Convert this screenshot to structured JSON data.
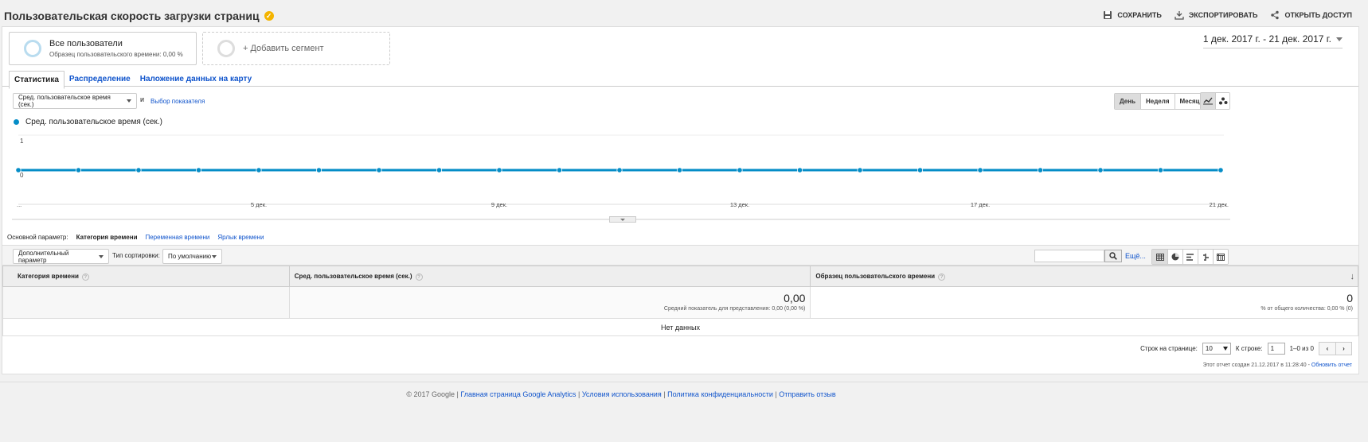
{
  "header": {
    "title": "Пользовательская скорость загрузки страниц",
    "verified_glyph": "✓",
    "actions": {
      "save": "СОХРАНИТЬ",
      "export": "ЭКСПОРТИРОВАТЬ",
      "share": "ОТКРЫТЬ ДОСТУП"
    }
  },
  "segments": {
    "all_users": "Все пользователи",
    "sample": "Образец пользовательского времени: 0,00 %",
    "add": "+ Добавить сегмент"
  },
  "date_range": "1 дек. 2017 г. - 21 дек. 2017 г.",
  "tabs": [
    "Статистика",
    "Распределение",
    "Наложение данных на карту"
  ],
  "metric": {
    "selected": "Сред. пользовательское время (сек.)",
    "and": "и",
    "pick": "Выбор показателя"
  },
  "period_buttons": [
    "День",
    "Неделя",
    "Месяц"
  ],
  "colors": {
    "series": "#058dc7",
    "link": "#1155cc"
  },
  "chart_data": {
    "type": "line",
    "series": [
      {
        "name": "Сред. пользовательское время (сек.)",
        "x": [
          "1 дек.",
          "2 дек.",
          "3 дек.",
          "4 дек.",
          "5 дек.",
          "6 дек.",
          "7 дек.",
          "8 дек.",
          "9 дек.",
          "10 дек.",
          "11 дек.",
          "12 дек.",
          "13 дек.",
          "14 дек.",
          "15 дек.",
          "16 дек.",
          "17 дек.",
          "18 дек.",
          "19 дек.",
          "20 дек.",
          "21 дек."
        ],
        "values": [
          0,
          0,
          0,
          0,
          0,
          0,
          0,
          0,
          0,
          0,
          0,
          0,
          0,
          0,
          0,
          0,
          0,
          0,
          0,
          0,
          0
        ]
      }
    ],
    "ylim": [
      0,
      1
    ],
    "y_ticks": [
      "1",
      "0"
    ],
    "x_ticks": [
      {
        "index": 0,
        "label": "..."
      },
      {
        "index": 4,
        "label": "5 дек."
      },
      {
        "index": 8,
        "label": "9 дек."
      },
      {
        "index": 12,
        "label": "13 дек."
      },
      {
        "index": 16,
        "label": "17 дек."
      },
      {
        "index": 20,
        "label": "21 дек."
      }
    ],
    "grid": true,
    "legend": "top-left"
  },
  "primary_dimension": {
    "label": "Основной параметр:",
    "current": "Категория времени",
    "options": [
      "Переменная времени",
      "Ярлык времени"
    ]
  },
  "toolbar": {
    "secondary": "Дополнительный параметр",
    "sort_label": "Тип сортировки:",
    "sort_value": "По умолчанию",
    "more": "Ещё..."
  },
  "table": {
    "headers": [
      "Категория времени",
      "Сред. пользовательское время (сек.)",
      "Образец пользовательского времени"
    ],
    "help_glyph": "?",
    "sort_glyph": "↓",
    "totals": {
      "avg_value": "0,00",
      "avg_sub": "Средний показатель для представления: 0,00 (0,00 %)",
      "sample_value": "0",
      "sample_sub": "% от общего количества: 0,00 % (0)"
    },
    "no_data": "Нет данных"
  },
  "pager": {
    "rows_label": "Строк на странице:",
    "rows_value": "10",
    "goto_label": "К строке:",
    "goto_value": "1",
    "range": "1–0 из 0",
    "prev": "‹",
    "next": "›"
  },
  "created": {
    "text": "Этот отчет создан 21.12.2017 в 11:28:40 -",
    "refresh": "Обновить отчет"
  },
  "footer": {
    "copyright": "© 2017 Google |",
    "links": [
      "Главная страница Google Analytics",
      "Условия использования",
      "Политика конфиденциальности",
      "Отправить отзыв"
    ],
    "sep": "|"
  }
}
